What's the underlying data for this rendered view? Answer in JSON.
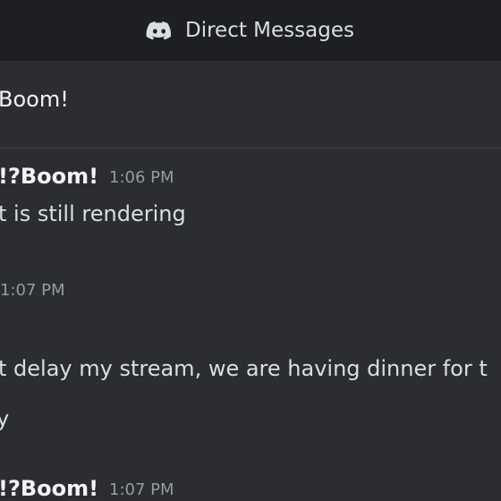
{
  "topbar": {
    "icon": "discord-logo-icon",
    "title": "Direct Messages"
  },
  "conversation": {
    "header_name": "Boom!"
  },
  "messages": [
    {
      "author": "!?Boom!",
      "time": "1:06 PM",
      "text": "t is still rendering"
    },
    {
      "time": "1:07 PM",
      "text_lines": [
        "t delay my stream, we are having dinner for t",
        "y"
      ]
    },
    {
      "author": "!?Boom!",
      "time": "1:07 PM"
    }
  ],
  "colors": {
    "background": "#2b2d31",
    "topbar": "#1e1f22",
    "text": "#dbdee1",
    "timestamp": "#949ba4"
  }
}
